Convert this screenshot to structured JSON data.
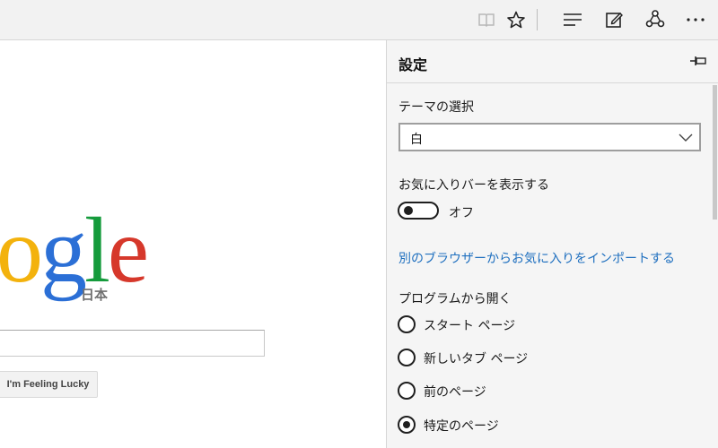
{
  "toolbar": {
    "icons": [
      "reading-view-icon",
      "favorite-star-icon",
      "hub-icon",
      "web-note-icon",
      "share-icon",
      "more-icon"
    ]
  },
  "page": {
    "logo_text": "ogle",
    "logo_sub": "日本",
    "search_value": "",
    "lucky_label": "I'm Feeling Lucky"
  },
  "settings": {
    "title": "設定",
    "theme_label": "テーマの選択",
    "theme_value": "白",
    "favbar_label": "お気に入りバーを表示する",
    "favbar_state": "オフ",
    "import_link": "別のブラウザーからお気に入りをインポートする",
    "open_with_label": "プログラムから開く",
    "open_with_options": [
      {
        "label": "スタート ページ",
        "selected": false
      },
      {
        "label": "新しいタブ ページ",
        "selected": false
      },
      {
        "label": "前のページ",
        "selected": false
      },
      {
        "label": "特定のページ",
        "selected": true
      }
    ]
  }
}
